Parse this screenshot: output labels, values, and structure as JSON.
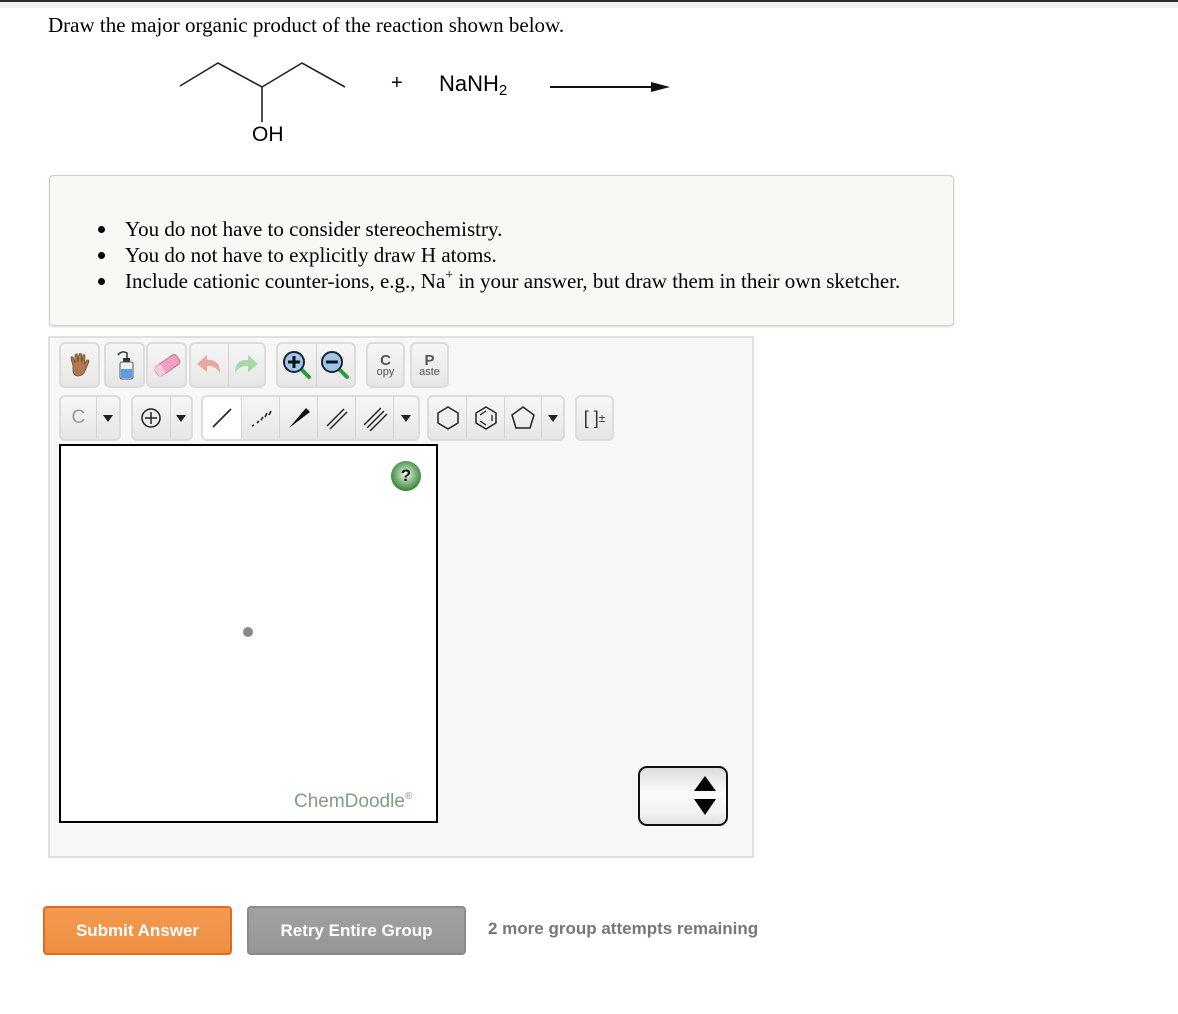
{
  "question": {
    "prompt": "Draw the major organic product of the reaction shown below."
  },
  "reaction": {
    "reactant_name": "3-pentanol (skeletal structure)",
    "hydroxyl_label": "OH",
    "plus": "+",
    "reagent_main": "NaNH",
    "reagent_subscript": "2",
    "arrow": "reaction-arrow"
  },
  "notes": {
    "items": [
      {
        "text": "You do not have to consider stereochemistry."
      },
      {
        "text": "You do not have to explicitly draw H atoms."
      },
      {
        "text_before": "Include cationic counter-ions, e.g., Na",
        "superscript": "+",
        "text_after": " in your answer, but draw them in their own sketcher."
      }
    ]
  },
  "editor": {
    "toolbar_row1": [
      {
        "name": "hand-tool",
        "icon": "hand-icon"
      },
      {
        "name": "clear-tool",
        "icon": "wash-bottle-icon"
      },
      {
        "name": "erase-tool",
        "icon": "eraser-icon"
      },
      {
        "name": "undo",
        "icon": "undo-arrow-icon"
      },
      {
        "name": "redo",
        "icon": "redo-arrow-icon"
      },
      {
        "name": "zoom-in",
        "icon": "zoom-in-icon"
      },
      {
        "name": "zoom-out",
        "icon": "zoom-out-icon"
      },
      {
        "name": "copy",
        "label_big": "C",
        "label_small": "opy"
      },
      {
        "name": "paste",
        "label_big": "P",
        "label_small": "aste"
      }
    ],
    "toolbar_row2": {
      "atom_label": "C",
      "charge_icon": "charge-plus-icon",
      "bonds": [
        "single-bond-icon",
        "dashed-bond-icon",
        "wedge-bond-icon",
        "double-bond-icon",
        "triple-bond-icon"
      ],
      "rings": [
        "cyclohexane-icon",
        "benzene-icon",
        "cyclopentane-icon"
      ],
      "bracket_label": "[ ]",
      "bracket_charge": "±"
    },
    "help_label": "?",
    "brand": "ChemDoodle",
    "brand_mark": "®"
  },
  "actions": {
    "submit_label": "Submit Answer",
    "retry_label": "Retry Entire Group",
    "attempts_text": "2 more group attempts remaining"
  },
  "colors": {
    "submit_bg": "#ee8e40",
    "retry_bg": "#999999",
    "brand_text": "#7fa07f",
    "attempts_text": "#777777"
  }
}
